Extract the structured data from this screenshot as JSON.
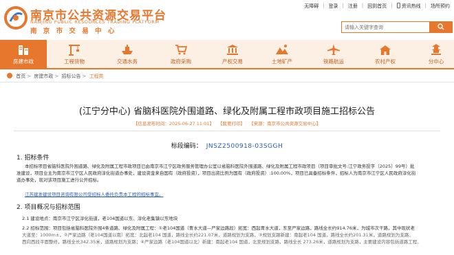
{
  "header": {
    "title": "南京市公共资源交易平台",
    "title_en": "NANJING PUBLIC RESOURCES TRADING PLATFORM",
    "subtitle": "南 京 市 交 易 中 心",
    "top_links": [
      "无障碍",
      "登录",
      "注册",
      "回到首页",
      "资讯热线",
      "场所预约"
    ],
    "search": {
      "placeholder": "请输入关键字查询"
    },
    "brand_color": "#e8772e"
  },
  "nav": {
    "items": [
      {
        "label": "房建市政",
        "icon": "building-icon",
        "active": true
      },
      {
        "label": "工程货物",
        "icon": "crane-icon",
        "active": false
      },
      {
        "label": "交通水务",
        "icon": "boat-icon",
        "active": false
      },
      {
        "label": "政府采购",
        "icon": "cart-icon",
        "active": false
      },
      {
        "label": "产权交易",
        "icon": "bank-icon",
        "active": false
      },
      {
        "label": "土地矿产",
        "icon": "land-icon",
        "active": false
      },
      {
        "label": "铁路航运",
        "icon": "plane-icon",
        "active": false
      },
      {
        "label": "农村产权",
        "icon": "farm-icon",
        "active": false
      },
      {
        "label": "分中心",
        "icon": "pagoda-icon",
        "active": false
      }
    ]
  },
  "breadcrumb": [
    "首页",
    "房建市政",
    "招标公告",
    "工程类"
  ],
  "article": {
    "title": "(江宁分中心) 省脑科医院外围道路、绿化及附属工程市政项目施工招标公告",
    "meta": [
      "【信息发布时间：2025-06-27 11:01】",
      "【我要打印】",
      "【来源：南京市公共资源交易中心】"
    ],
    "code_label": "标段编码：",
    "code_value": "JNSZ2500918-03SGGH",
    "section1": "1. 招标条件",
    "para1": [
      "本招标项目省脑科医院外围道路、绿化及附属工程市政项目已由南京市江宁区政务服务管理办公室以省脑科医院外围道路、绿化及附属工程市政项目（项目审批文号:江宁政务投字〔2025〕99号）批",
      "准建设，项目业主为南京市江宁区人民政府淳化街道办事处，建设资金来自国有（政府投资），项目出资比例为国有（政府投资）:100.00%，项目已具备招标条件，招标人为南京市江宁区人民政府淳化街",
      "道办事处，现对该项目施工进行公开招标。"
    ],
    "agent": "江苏建发建设项目咨询有限公司受招标人委托负责本工程的招标事宜。",
    "section2": "2. 项目概况与招标范围",
    "para21": "2.1 建设地点：南京市江宁区淳化街道，老104国道以东、淳化老集镇以东地块",
    "para22": [
      "2.2 招标范围：项目包括省脑科医院外围4条道路、绿化及附属工程：①老104国道（青水大道—严家边路段）拓宽：西起青水大道，东至严家边路，路线全长约914.76米，为城市次干路，其中现状老",
      "大道至：1000m±，②严家边路（老104国道以南）拓宽：北起老104 国道，路线全长约221.07米，道路规划为支路，③规划支路新建：南起老104 国道，路线全长约201.31米，道路规划为支路，",
      "西向西段平面整修，路线全长342.35米，道路规划为支路；④严家边路（老104国道以北）新建：南起老104 国道，北至规划支路，路线全长 273.26米，道路规划为支路，主要建设内容包括道路工程、"
    ]
  }
}
